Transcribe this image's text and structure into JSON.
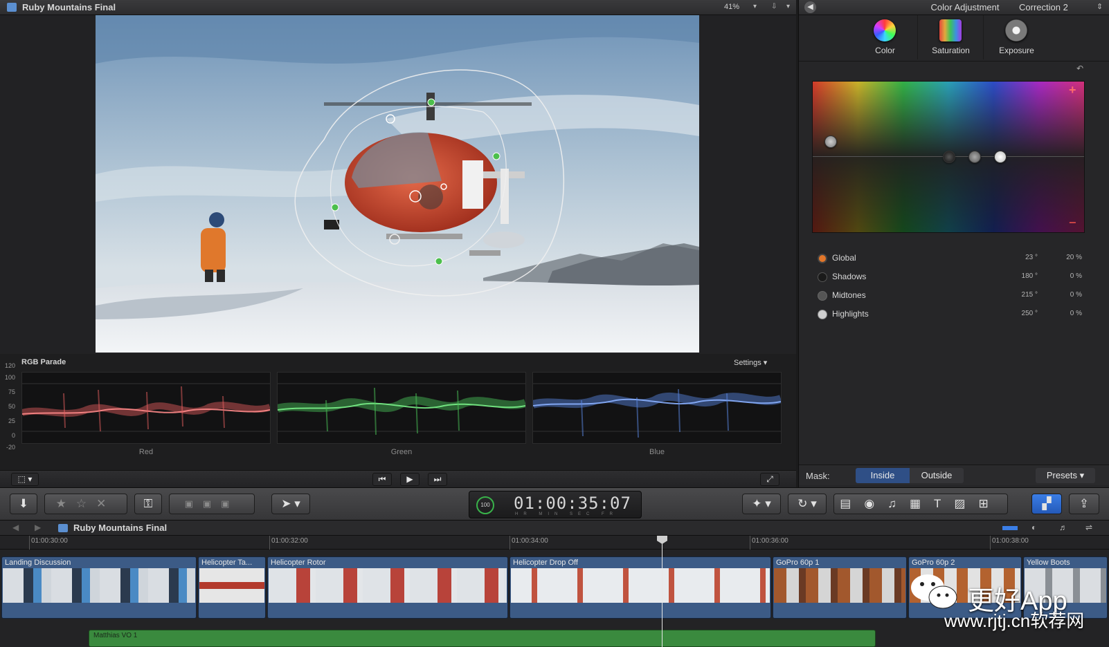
{
  "viewer": {
    "title": "Ruby Mountains Final",
    "zoom": "41%"
  },
  "scopes": {
    "title": "RGB Parade",
    "settings_label": "Settings",
    "y_ticks": [
      "120",
      "100",
      "75",
      "50",
      "25",
      "0",
      "-20"
    ],
    "channels": [
      {
        "label": "Red",
        "color": "#e86060"
      },
      {
        "label": "Green",
        "color": "#4cc85a"
      },
      {
        "label": "Blue",
        "color": "#5c8ae6"
      }
    ]
  },
  "inspector": {
    "title": "Color Adjustment",
    "correction": "Correction 2",
    "tabs": [
      {
        "label": "Color",
        "icon": "color-wheel-icon"
      },
      {
        "label": "Saturation",
        "icon": "saturation-icon"
      },
      {
        "label": "Exposure",
        "icon": "exposure-icon"
      }
    ],
    "ranges": [
      {
        "label": "Global",
        "angle": "23 °",
        "pct": "20 %",
        "active": true
      },
      {
        "label": "Shadows",
        "angle": "180 °",
        "pct": "0 %"
      },
      {
        "label": "Midtones",
        "angle": "215 °",
        "pct": "0 %"
      },
      {
        "label": "Highlights",
        "angle": "250 °",
        "pct": "0 %"
      }
    ],
    "mask_label": "Mask:",
    "mask_inside": "Inside",
    "mask_outside": "Outside",
    "presets": "Presets"
  },
  "toolbar": {
    "timecode": "01:00:35:07",
    "timecode_sub": "HR MIN SEC FR",
    "gauge": "100",
    "accent": "#2f6fd6"
  },
  "timeline": {
    "title": "Ruby Mountains Final",
    "ruler": [
      "01:00:30:00",
      "01:00:32:00",
      "01:00:34:00",
      "01:00:36:00",
      "01:00:38:00"
    ],
    "clips": [
      {
        "name": "Landing Discussion"
      },
      {
        "name": "Helicopter Ta..."
      },
      {
        "name": "Helicopter Rotor"
      },
      {
        "name": "Helicopter Drop Off"
      },
      {
        "name": "GoPro 60p 1"
      },
      {
        "name": "GoPro 60p 2"
      },
      {
        "name": "Yellow Boots"
      }
    ],
    "audio_clip": "Matthias VO 1"
  },
  "watermark": {
    "app": "更好App",
    "site": "www.rjtj.cn软荐网"
  }
}
